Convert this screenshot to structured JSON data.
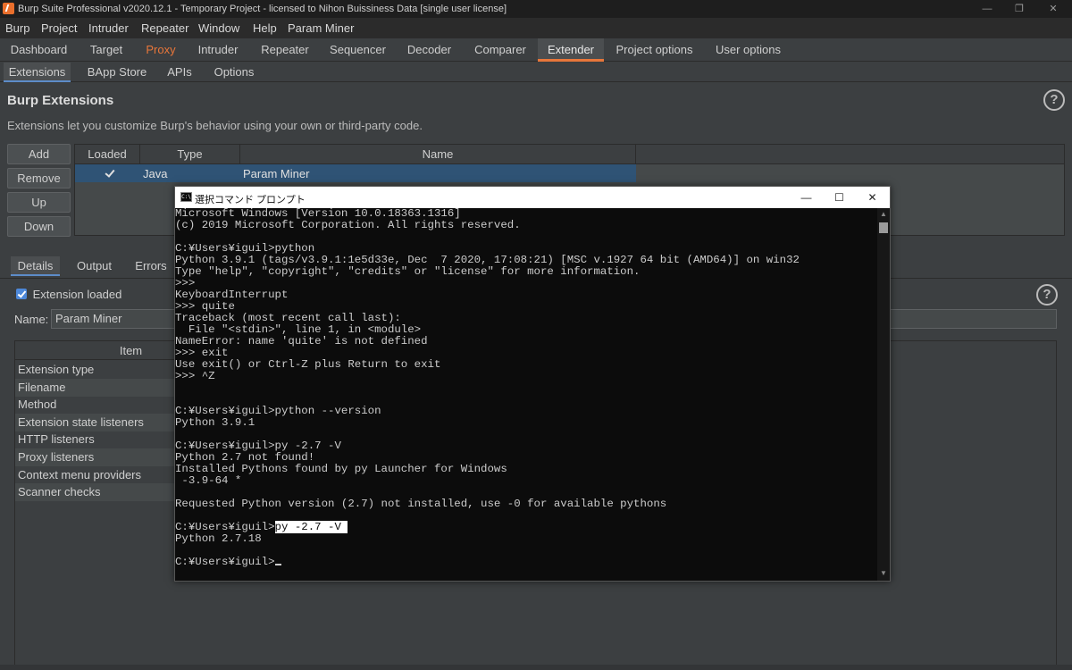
{
  "titlebar": {
    "title": "Burp Suite Professional v2020.12.1 - Temporary Project - licensed to Nihon Buissiness Data [single user license]",
    "minimize": "—",
    "restore": "❐",
    "close": "✕"
  },
  "menu": [
    "Burp",
    "Project",
    "Intruder",
    "Repeater",
    "Window",
    "Help",
    "Param Miner"
  ],
  "tabs": [
    "Dashboard",
    "Target",
    "Proxy",
    "Intruder",
    "Repeater",
    "Sequencer",
    "Decoder",
    "Comparer",
    "Extender",
    "Project options",
    "User options"
  ],
  "active_tab": "Extender",
  "subtabs": [
    "Extensions",
    "BApp Store",
    "APIs",
    "Options"
  ],
  "active_subtab": "Extensions",
  "section": {
    "title": "Burp Extensions",
    "description": "Extensions let you customize Burp's behavior using your own or third-party code.",
    "help_glyph": "?"
  },
  "buttons": {
    "add": "Add",
    "remove": "Remove",
    "up": "Up",
    "down": "Down"
  },
  "ext_table": {
    "headers": {
      "loaded": "Loaded",
      "type": "Type",
      "name": "Name"
    },
    "row": {
      "type": "Java",
      "name": "Param Miner"
    }
  },
  "details": {
    "tabs": [
      "Details",
      "Output",
      "Errors"
    ],
    "active": "Details",
    "checkbox_label": "Extension loaded",
    "name_label": "Name:",
    "name_value": "Param Miner",
    "item_header": "Item",
    "items": [
      "Extension type",
      "Filename",
      "Method",
      "Extension state listeners",
      "HTTP listeners",
      "Proxy listeners",
      "Context menu providers",
      "Scanner checks"
    ]
  },
  "cmd": {
    "title": "選択コマンド プロンプト",
    "icon_text": "C:\\",
    "minimize": "—",
    "maximize": "☐",
    "close": "✕",
    "lines": [
      "Microsoft Windows [Version 10.0.18363.1316]",
      "(c) 2019 Microsoft Corporation. All rights reserved.",
      "",
      "C:¥Users¥iguil>python",
      "Python 3.9.1 (tags/v3.9.1:1e5d33e, Dec  7 2020, 17:08:21) [MSC v.1927 64 bit (AMD64)] on win32",
      "Type \"help\", \"copyright\", \"credits\" or \"license\" for more information.",
      ">>>",
      "KeyboardInterrupt",
      ">>> quite",
      "Traceback (most recent call last):",
      "  File \"<stdin>\", line 1, in <module>",
      "NameError: name 'quite' is not defined",
      ">>> exit",
      "Use exit() or Ctrl-Z plus Return to exit",
      ">>> ^Z",
      "",
      "",
      "C:¥Users¥iguil>python --version",
      "Python 3.9.1",
      "",
      "C:¥Users¥iguil>py -2.7 -V",
      "Python 2.7 not found!",
      "Installed Pythons found by py Launcher for Windows",
      " -3.9-64 *",
      "",
      "Requested Python version (2.7) not installed, use -0 for available pythons",
      "",
      "",
      "Python 2.7.18",
      "",
      "C:¥Users¥iguil>"
    ],
    "selected_line": {
      "prompt": "C:¥Users¥iguil>",
      "selected": "py -2.7 -V "
    }
  }
}
